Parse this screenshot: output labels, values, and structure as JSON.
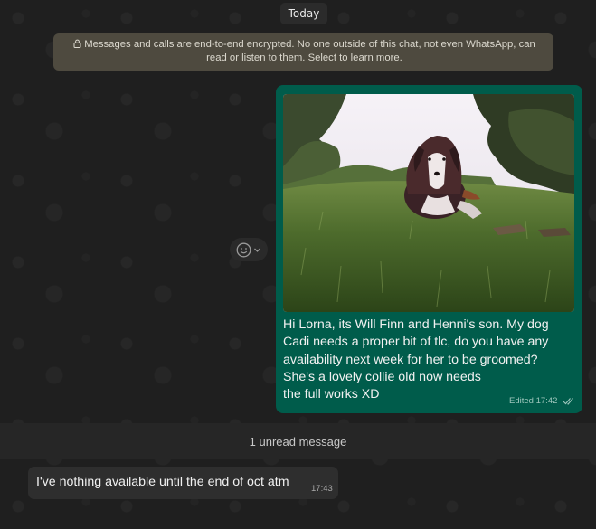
{
  "chat": {
    "date_label": "Today",
    "encryption_notice": "Messages and calls are end-to-end encrypted. No one outside of this chat, not even WhatsApp, can read or listen to them. Select to learn more.",
    "outgoing": {
      "text": "Hi Lorna, its Will Finn and Henni's son. My dog\nCadi needs a proper bit of tlc, do you have any\navailability next week for her to be groomed?\nShe's a lovely collie old now needs\nthe full works XD",
      "meta": "Edited 17:42",
      "status_icon": "double-check-icon"
    },
    "unread_label": "1 unread message",
    "incoming": {
      "text": "I've nothing available until the end of oct atm",
      "time": "17:43"
    }
  },
  "colors": {
    "background": "#1e1e1e",
    "outgoing_bubble": "#005c4b",
    "incoming_bubble": "#2e2e2e",
    "notice_bg": "#4e4a3f"
  }
}
